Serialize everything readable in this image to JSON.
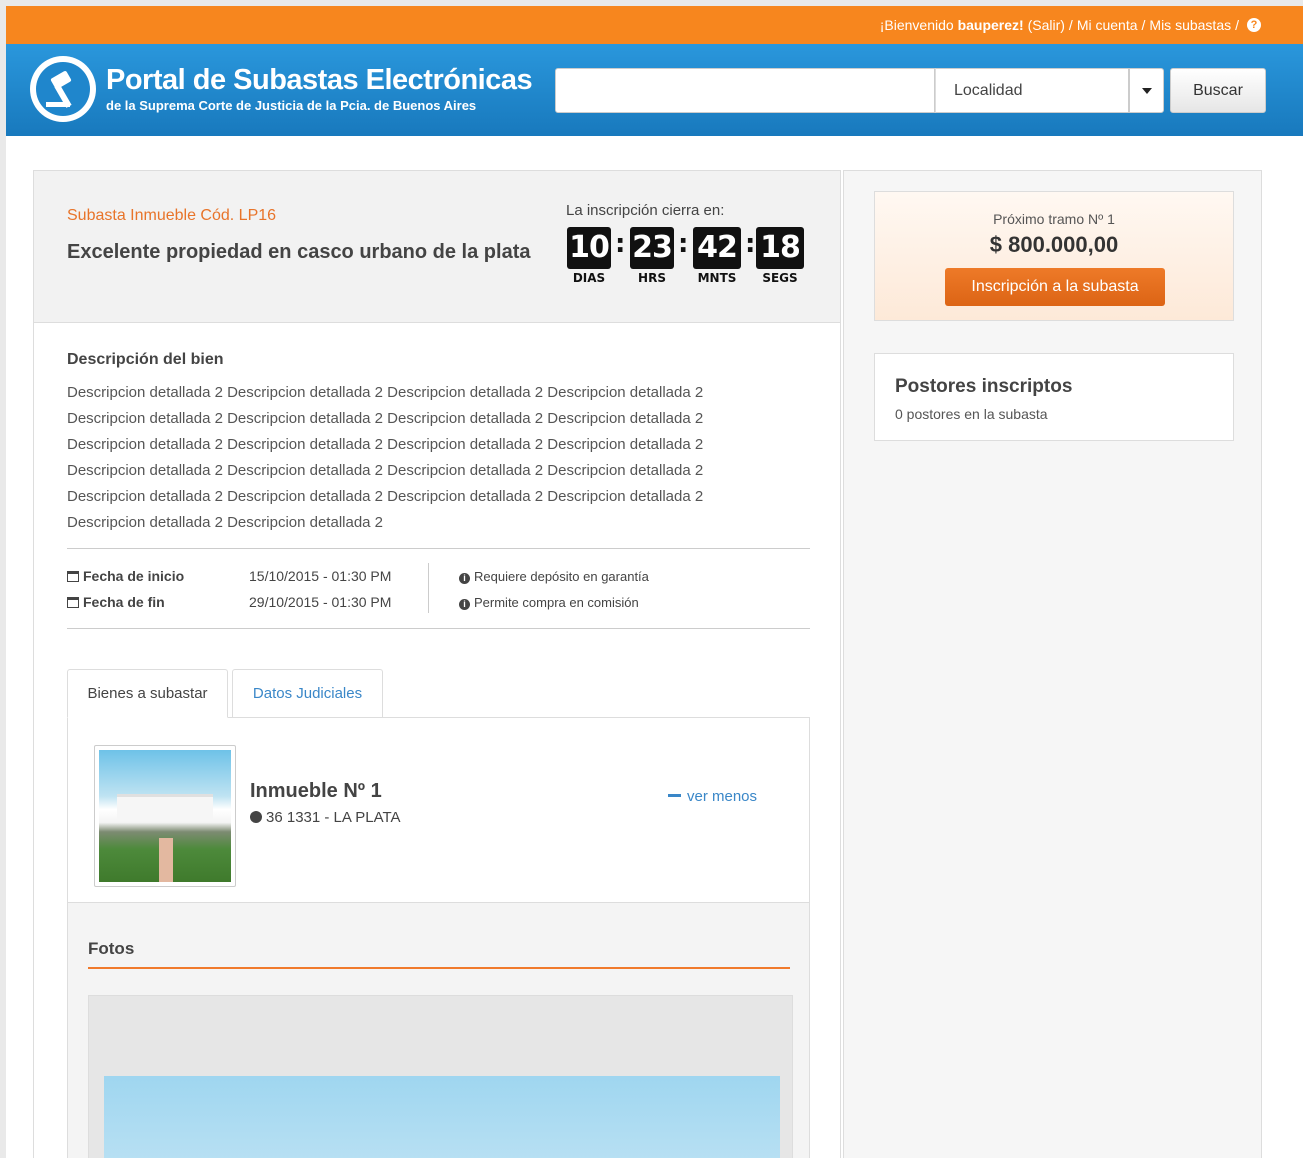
{
  "topbar": {
    "welcome_prefix": "¡Bienvenido",
    "username": "bauperez!",
    "logout": "(Salir)",
    "sep1": "/",
    "account": "Mi cuenta",
    "sep2": "/",
    "my_auctions": "Mis subastas",
    "sep3": "/",
    "help_glyph": "?"
  },
  "header": {
    "title": "Portal de Subastas Electrónicas",
    "subtitle": "de la Suprema Corte de Justicia de la Pcia. de Buenos Aires",
    "search_value": "",
    "locality_selected": "Localidad",
    "search_button": "Buscar"
  },
  "auction": {
    "code": "Subasta Inmueble Cód. LP16",
    "title": "Excelente propiedad en casco urbano de la plata",
    "countdown_label": "La inscripción cierra en:",
    "countdown": {
      "days": "10",
      "days_unit": "DIAS",
      "hours": "23",
      "hours_unit": "HRS",
      "minutes": "42",
      "minutes_unit": "MNTS",
      "seconds": "18",
      "seconds_unit": "SEGS"
    },
    "description_title": "Descripción del bien",
    "description": [
      "Descripcion detallada 2 Descripcion detallada 2 Descripcion detallada 2 Descripcion detallada 2",
      "Descripcion detallada 2 Descripcion detallada 2 Descripcion detallada 2 Descripcion detallada 2",
      "Descripcion detallada 2 Descripcion detallada 2 Descripcion detallada 2 Descripcion detallada 2",
      "Descripcion detallada 2 Descripcion detallada 2 Descripcion detallada 2 Descripcion detallada 2",
      "Descripcion detallada 2 Descripcion detallada 2 Descripcion detallada 2 Descripcion detallada 2",
      "Descripcion detallada 2 Descripcion detallada 2"
    ],
    "start_label": "Fecha de inicio",
    "start_value": "15/10/2015 - 01:30 PM",
    "end_label": "Fecha de fin",
    "end_value": "29/10/2015 - 01:30 PM",
    "info1": "Requiere depósito en garantía",
    "info2": "Permite compra en comisión"
  },
  "tabs": [
    {
      "label": "Bienes a subastar",
      "active": true
    },
    {
      "label": "Datos Judiciales",
      "active": false
    }
  ],
  "property": {
    "title": "Inmueble Nº 1",
    "location": "36 1331 - LA PLATA",
    "toggle": "ver menos",
    "photos_title": "Fotos"
  },
  "sidebar": {
    "next_bid_label": "Próximo tramo Nº 1",
    "next_bid_amount": "$ 800.000,00",
    "register_button": "Inscripción a la subasta",
    "bidders_title": "Postores inscriptos",
    "bidders_count": "0 postores en la subasta"
  },
  "colors": {
    "topbar": "#f7861e",
    "header": "#1f86cc",
    "accent_orange": "#e8742a",
    "link_blue": "#3a87c8"
  }
}
